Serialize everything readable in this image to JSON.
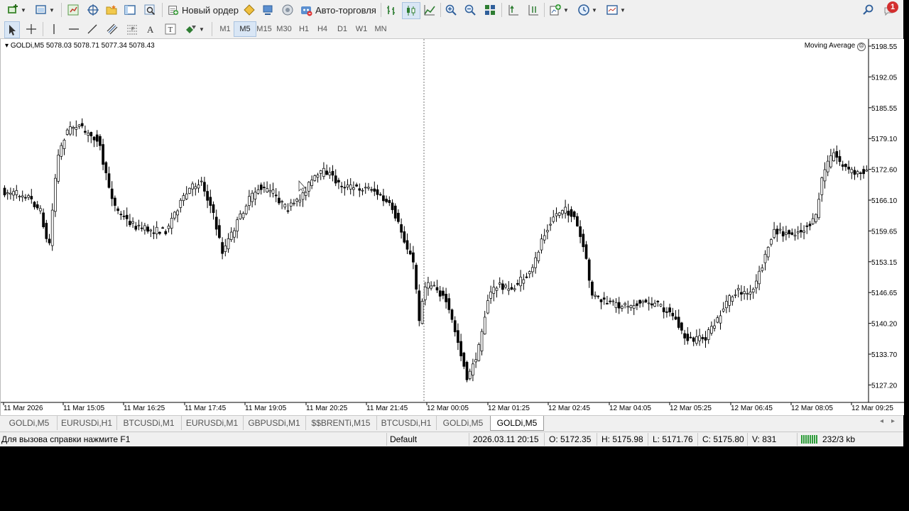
{
  "toolbar": {
    "new_order_label": "Новый ордер",
    "auto_trading_label": "Авто-торговля",
    "notification_count": "1"
  },
  "timeframes": [
    "M1",
    "M5",
    "M15",
    "M30",
    "H1",
    "H4",
    "D1",
    "W1",
    "MN"
  ],
  "active_timeframe": "M5",
  "chart": {
    "symbol_info": "GOLDi,M5  5078.03 5078.71 5077.34 5078.43",
    "indicator_label": "Moving Average",
    "price_labels": [
      "5198.55",
      "5192.05",
      "5185.55",
      "5179.10",
      "5172.60",
      "5166.10",
      "5159.65",
      "5153.15",
      "5146.65",
      "5140.20",
      "5133.70",
      "5127.20"
    ],
    "time_labels": [
      "11 Mar 2026",
      "11 Mar 15:05",
      "11 Mar 16:25",
      "11 Mar 17:45",
      "11 Mar 19:05",
      "11 Mar 20:25",
      "11 Mar 21:45",
      "12 Mar 00:05",
      "12 Mar 01:25",
      "12 Mar 02:45",
      "12 Mar 04:05",
      "12 Mar 05:25",
      "12 Mar 06:45",
      "12 Mar 08:05",
      "12 Mar 09:25"
    ],
    "colors": {
      "bull": "#ffffff",
      "bear": "#000000",
      "wick": "#000000",
      "background": "#ffffff",
      "period_separator": "#777777"
    }
  },
  "tabs": [
    "GOLDi,M5",
    "EURUSDi,H1",
    "BTCUSDi,M1",
    "EURUSDi,M1",
    "GBPUSDi,M1",
    "$$BRENTi,M15",
    "BTCUSDi,H1",
    "GOLDi,M5",
    "GOLDi,M5"
  ],
  "active_tab_index": 8,
  "status": {
    "help": "Для вызова справки нажмите F1",
    "profile": "Default",
    "datetime": "2026.03.11 20:15",
    "open": "O: 5172.35",
    "high": "H: 5175.98",
    "low": "L: 5171.76",
    "close": "C: 5175.80",
    "volume": "V: 831",
    "connection": "232/3 kb"
  }
}
